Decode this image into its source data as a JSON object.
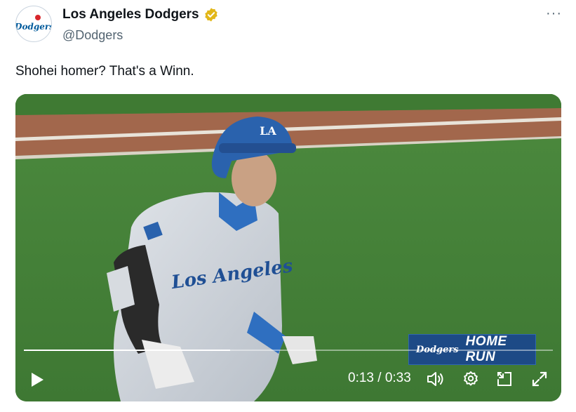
{
  "author": {
    "display_name": "Los Angeles Dodgers",
    "handle": "@Dodgers",
    "avatar_text": "Dodgers",
    "verified_color": "#e2b719"
  },
  "post": {
    "text": "Shohei homer? That's a Winn.",
    "more_label": "···"
  },
  "video": {
    "overlay_logo_text": "Dodgers",
    "overlay_text": "HOME RUN",
    "current_time": "0:13",
    "separator": "/",
    "duration": "0:33",
    "progress": 0.39,
    "jersey_text": "Los Angeles",
    "helmet_text": "LA"
  },
  "colors": {
    "dodger_blue": "#005a9c",
    "overlay_blue": "#1d4a86"
  }
}
